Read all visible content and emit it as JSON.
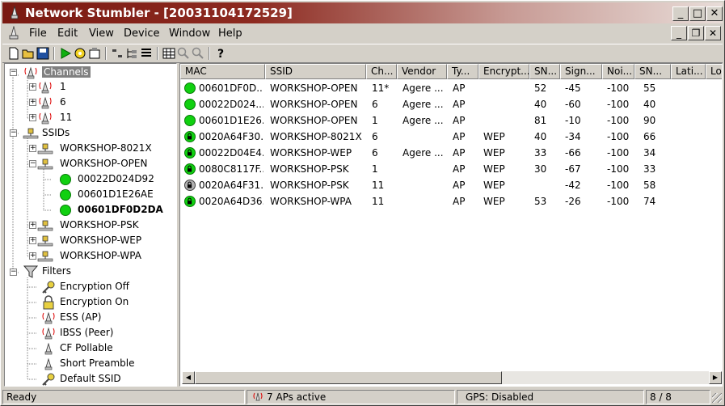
{
  "window": {
    "title": "Network Stumbler - [20031104172529]"
  },
  "menu": [
    "File",
    "Edit",
    "View",
    "Device",
    "Window",
    "Help"
  ],
  "colors": {
    "title_start": "#7a1a12",
    "ap_dot": "#10d010",
    "selected_bg": "#808080"
  },
  "tree": {
    "channels_label": "Channels",
    "channels": [
      "1",
      "6",
      "11"
    ],
    "ssids_label": "SSIDs",
    "ssids": [
      "WORKSHOP-8021X",
      "WORKSHOP-OPEN",
      "WORKSHOP-PSK",
      "WORKSHOP-WEP",
      "WORKSHOP-WPA"
    ],
    "open_children": [
      "00022D024D92",
      "00601D1E26AE",
      "00601DF0D2DA"
    ],
    "filters_label": "Filters",
    "filters": [
      "Encryption Off",
      "Encryption On",
      "ESS (AP)",
      "IBSS (Peer)",
      "CF Pollable",
      "Short Preamble",
      "Default SSID"
    ]
  },
  "list": {
    "columns": [
      "MAC",
      "SSID",
      "Ch...",
      "Vendor",
      "Ty...",
      "Encrypt...",
      "SN...",
      "Sign...",
      "Noi...",
      "SN...",
      "Lati...",
      "Lo"
    ],
    "rows": [
      {
        "mac": "00601DF0D...",
        "ssid": "WORKSHOP-OPEN",
        "ch": "11*",
        "vendor": "Agere ...",
        "type": "AP",
        "enc": "",
        "snr": "52",
        "signal": "-45",
        "noise": "-100",
        "snr2": "55",
        "lock": false
      },
      {
        "mac": "00022D024...",
        "ssid": "WORKSHOP-OPEN",
        "ch": "6",
        "vendor": "Agere ...",
        "type": "AP",
        "enc": "",
        "snr": "40",
        "signal": "-60",
        "noise": "-100",
        "snr2": "40",
        "lock": false
      },
      {
        "mac": "00601D1E26...",
        "ssid": "WORKSHOP-OPEN",
        "ch": "1",
        "vendor": "Agere ...",
        "type": "AP",
        "enc": "",
        "snr": "81",
        "signal": "-10",
        "noise": "-100",
        "snr2": "90",
        "lock": false
      },
      {
        "mac": "0020A64F30...",
        "ssid": "WORKSHOP-8021X",
        "ch": "6",
        "vendor": "",
        "type": "AP",
        "enc": "WEP",
        "snr": "40",
        "signal": "-34",
        "noise": "-100",
        "snr2": "66",
        "lock": true
      },
      {
        "mac": "00022D04E4...",
        "ssid": "WORKSHOP-WEP",
        "ch": "6",
        "vendor": "Agere ...",
        "type": "AP",
        "enc": "WEP",
        "snr": "33",
        "signal": "-66",
        "noise": "-100",
        "snr2": "34",
        "lock": true
      },
      {
        "mac": "0080C8117F...",
        "ssid": "WORKSHOP-PSK",
        "ch": "1",
        "vendor": "",
        "type": "AP",
        "enc": "WEP",
        "snr": "30",
        "signal": "-67",
        "noise": "-100",
        "snr2": "33",
        "lock": true
      },
      {
        "mac": "0020A64F31...",
        "ssid": "WORKSHOP-PSK",
        "ch": "11",
        "vendor": "",
        "type": "AP",
        "enc": "WEP",
        "snr": "",
        "signal": "-42",
        "noise": "-100",
        "snr2": "58",
        "lock": true,
        "gray": true
      },
      {
        "mac": "0020A64D36...",
        "ssid": "WORKSHOP-WPA",
        "ch": "11",
        "vendor": "",
        "type": "AP",
        "enc": "WEP",
        "snr": "53",
        "signal": "-26",
        "noise": "-100",
        "snr2": "74",
        "lock": true
      }
    ]
  },
  "status": {
    "ready": "Ready",
    "aps": "7 APs active",
    "gps": "GPS: Disabled",
    "count": "8 / 8"
  }
}
